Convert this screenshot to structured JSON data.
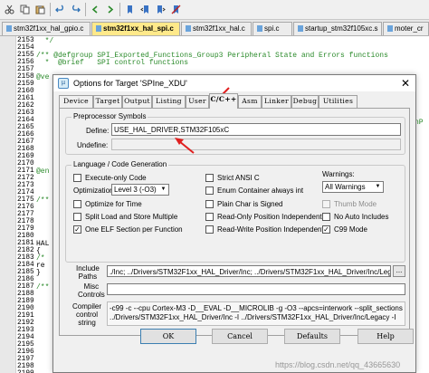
{
  "toolbar": {
    "icons": [
      "cut-icon",
      "copy-icon",
      "paste-icon",
      "undo-icon",
      "redo-icon",
      "nav-back-icon",
      "nav-forward-icon",
      "bookmark-icon",
      "bookmark-prev-icon",
      "bookmark-next-icon",
      "bookmark-clear-icon"
    ]
  },
  "file_tabs": [
    {
      "label": "stm32f1xx_hal_gpio.c",
      "color": "#6aa4dc"
    },
    {
      "label": "stm32f1xx_hal_spi.c",
      "color": "#6aa4dc",
      "active": true
    },
    {
      "label": "stm32f1xx_hal.c",
      "color": "#6aa4dc"
    },
    {
      "label": "spi.c",
      "color": "#6aa4dc"
    },
    {
      "label": "startup_stm32f105xc.s",
      "color": "#6aa4dc"
    },
    {
      "label": "moter_cr",
      "color": "#6aa4dc"
    }
  ],
  "editor": {
    "line_numbers": [
      "2153",
      "2154",
      "2155",
      "2156",
      "2157",
      "2158",
      "2159",
      "2160",
      "2161",
      "2162",
      "2163",
      "2164",
      "2165",
      "2166",
      "2167",
      "2168",
      "2169",
      "2170",
      "2171",
      "2172",
      "2173",
      "2174",
      "2175",
      "2176",
      "2177",
      "2178",
      "2179",
      "2180",
      "2181",
      "2182",
      "2183",
      "2184",
      "2185",
      "2186",
      "2187",
      "2188",
      "2189",
      "2190",
      "2191",
      "2192",
      "2193",
      "2194",
      "2195",
      "2196",
      "2197",
      "2198",
      "2199"
    ],
    "lines": [
      {
        "text": "  */",
        "dark": false
      },
      {
        "text": "",
        "dark": false
      },
      {
        "text": "/** @defgroup SPI_Exported_Functions_Group3 Peripheral State and Errors functions",
        "dark": false
      },
      {
        "text": "  *  @brief   SPI control functions",
        "dark": false
      },
      {
        "text": "",
        "dark": false
      },
      {
        "text": "@ve",
        "dark": false
      },
      {
        "text": "",
        "dark": false
      },
      {
        "text": "",
        "dark": false
      },
      {
        "text": "",
        "dark": false
      },
      {
        "text": "",
        "dark": false
      },
      {
        "text": "",
        "dark": false
      },
      {
        "text": "",
        "dark": false
      },
      {
        "text": "",
        "dark": false
      },
      {
        "text": "",
        "dark": false
      },
      {
        "text": "",
        "dark": false
      },
      {
        "text": "",
        "dark": false
      },
      {
        "text": "",
        "dark": false
      },
      {
        "text": "",
        "dark": false
      },
      {
        "text": "@en",
        "dark": false
      },
      {
        "text": "",
        "dark": false
      },
      {
        "text": "",
        "dark": false
      },
      {
        "text": "",
        "dark": false
      },
      {
        "text": "/**",
        "dark": false
      },
      {
        "text": "",
        "dark": false
      },
      {
        "text": "",
        "dark": false
      },
      {
        "text": "",
        "dark": false
      },
      {
        "text": "",
        "dark": false
      },
      {
        "text": "",
        "dark": false
      },
      {
        "text": "HAL",
        "dark": true
      },
      {
        "text": "{",
        "dark": true
      },
      {
        "text": "/*",
        "dark": false
      },
      {
        "text": "re",
        "dark": true
      },
      {
        "text": "}",
        "dark": true
      },
      {
        "text": "",
        "dark": false
      },
      {
        "text": "/**",
        "dark": false
      },
      {
        "text": "",
        "dark": false
      },
      {
        "text": "",
        "dark": false
      },
      {
        "text": "",
        "dark": false
      },
      {
        "text": "",
        "dark": false
      },
      {
        "text": "",
        "dark": false
      },
      {
        "text": "",
        "dark": false
      },
      {
        "text": "",
        "dark": false
      },
      {
        "text": "",
        "dark": false
      },
      {
        "text": "",
        "dark": false
      },
      {
        "text": "",
        "dark": false
      },
      {
        "text": "",
        "dark": false
      },
      {
        "text": "",
        "dark": false
      }
    ],
    "right_edge_text": "nP"
  },
  "dialog": {
    "title": "Options for Target 'SPIne_XDU'",
    "close_label": "✕",
    "tabs": [
      "Device",
      "Target",
      "Output",
      "Listing",
      "User",
      "C/C++",
      "Asm",
      "Linker",
      "Debug",
      "Utilities"
    ],
    "selected_tab": "C/C++",
    "preprocessor": {
      "group_title": "Preprocessor Symbols",
      "define_label": "Define:",
      "define_value": "USE_HAL_DRIVER,STM32F105xC",
      "undefine_label": "Undefine:",
      "undefine_value": ""
    },
    "language": {
      "group_title": "Language / Code Generation",
      "execute_only": {
        "label": "Execute-only Code",
        "checked": false
      },
      "optimization_label": "Optimization:",
      "optimization_value": "Level 3 (-O3)",
      "optimize_time": {
        "label": "Optimize for Time",
        "checked": false
      },
      "split_load": {
        "label": "Split Load and Store Multiple",
        "checked": false
      },
      "one_elf": {
        "label": "One ELF Section per Function",
        "checked": true
      },
      "strict_ansi": {
        "label": "Strict ANSI C",
        "checked": false
      },
      "enum_int": {
        "label": "Enum Container always int",
        "checked": false
      },
      "plain_char": {
        "label": "Plain Char is Signed",
        "checked": false
      },
      "ro_pic": {
        "label": "Read-Only Position Independent",
        "checked": false
      },
      "rw_pic": {
        "label": "Read-Write Position Independent",
        "checked": false
      },
      "warnings_label": "Warnings:",
      "warnings_value": "All Warnings",
      "thumb_mode": {
        "label": "Thumb Mode",
        "checked": false,
        "disabled": true
      },
      "no_auto_includes": {
        "label": "No Auto Includes",
        "checked": false
      },
      "c99_mode": {
        "label": "C99 Mode",
        "checked": true
      }
    },
    "include_paths_label": "Include\nPaths",
    "include_paths_value": "./Inc;    ../Drivers/STM32F1xx_HAL_Driver/Inc;    ../Drivers/STM32F1xx_HAL_Driver/Inc/Legacy;",
    "browse_label": "...",
    "misc_controls_label": "Misc\nControls",
    "misc_controls_value": "",
    "compiler_control_label": "Compiler\ncontrol\nstring",
    "compiler_control_line1": "-c99 -c --cpu Cortex-M3 -D__EVAL -D__MICROLIB -g -O3 --apcs=interwork --split_sections -I../Inc -I",
    "compiler_control_line2": "../Drivers/STM32F1xx_HAL_Driver/Inc -I ../Drivers/STM32F1xx_HAL_Driver/Inc/Legacy -I",
    "buttons": {
      "ok": "OK",
      "cancel": "Cancel",
      "defaults": "Defaults",
      "help": "Help"
    }
  },
  "watermark": "https://blog.csdn.net/qq_43665630",
  "annotation_color": "#e02020"
}
